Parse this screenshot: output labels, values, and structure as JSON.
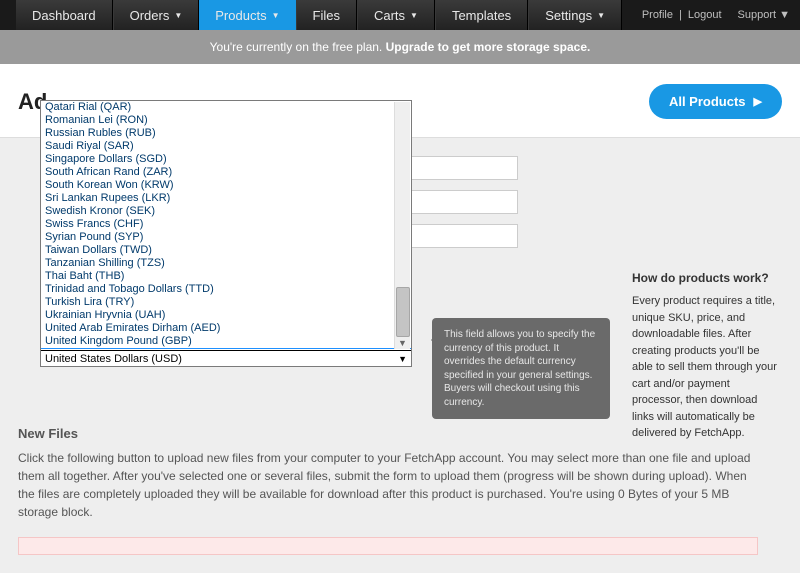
{
  "nav": {
    "items": [
      {
        "label": "Dashboard",
        "caret": false
      },
      {
        "label": "Orders",
        "caret": true
      },
      {
        "label": "Products",
        "caret": true,
        "active": true
      },
      {
        "label": "Files",
        "caret": false
      },
      {
        "label": "Carts",
        "caret": true
      },
      {
        "label": "Templates",
        "caret": false
      },
      {
        "label": "Settings",
        "caret": true
      }
    ]
  },
  "topright": {
    "profile": "Profile",
    "logout": "Logout",
    "support": "Support"
  },
  "banner": {
    "a": "You're currently on the free plan. ",
    "b": "Upgrade to get more storage space."
  },
  "page": {
    "title": "Ad",
    "all": "All Products"
  },
  "help": {
    "h": "How do products work?",
    "body": "Every product requires a title, unique SKU, price, and downloadable files. After creating products you'll be able to sell them through your cart and/or payment processor, then download links will automatically be delivered by FetchApp."
  },
  "tooltip": "This field allows you to specify the currency of this product. It overrides the default currency specified in your general settings. Buyers will checkout using this currency.",
  "newfiles": {
    "t": "New Files",
    "p": "Click the following button to upload new files from your computer to your FetchApp account. You may select more than one file and upload them all together. After you've selected one or several files, submit the form to upload them (progress will be shown during upload). When the files are completely uploaded they will be available for download after this product is purchased. You're using 0 Bytes of your 5 MB storage block."
  },
  "dropdown": {
    "items": [
      "Qatari Rial (QAR)",
      "Romanian Lei (RON)",
      "Russian Rubles (RUB)",
      "Saudi Riyal (SAR)",
      "Singapore Dollars (SGD)",
      "South African Rand (ZAR)",
      "South Korean Won (KRW)",
      "Sri Lankan Rupees (LKR)",
      "Swedish Kronor (SEK)",
      "Swiss Francs (CHF)",
      "Syrian Pound (SYP)",
      "Taiwan Dollars (TWD)",
      "Tanzanian Shilling (TZS)",
      "Thai Baht (THB)",
      "Trinidad and Tobago Dollars (TTD)",
      "Turkish Lira (TRY)",
      "Ukrainian Hryvnia (UAH)",
      "United Arab Emirates Dirham (AED)",
      "United Kingdom Pound (GBP)",
      "United States Dollars (USD)"
    ],
    "selectedIndex": 19,
    "current": "United States Dollars (USD)"
  }
}
